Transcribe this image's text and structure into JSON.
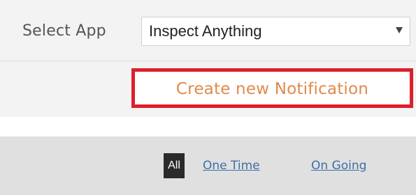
{
  "app_select": {
    "label": "Select App",
    "selected_value": "Inspect Anything",
    "caret_icon": "caret-down-icon"
  },
  "create_button": {
    "label": "Create new Notification",
    "border_color": "#dd1f2b",
    "text_color": "#e08a4a"
  },
  "filters": {
    "all_label": "All",
    "one_time_label": "One Time",
    "on_going_label": "On Going",
    "active": "All"
  }
}
